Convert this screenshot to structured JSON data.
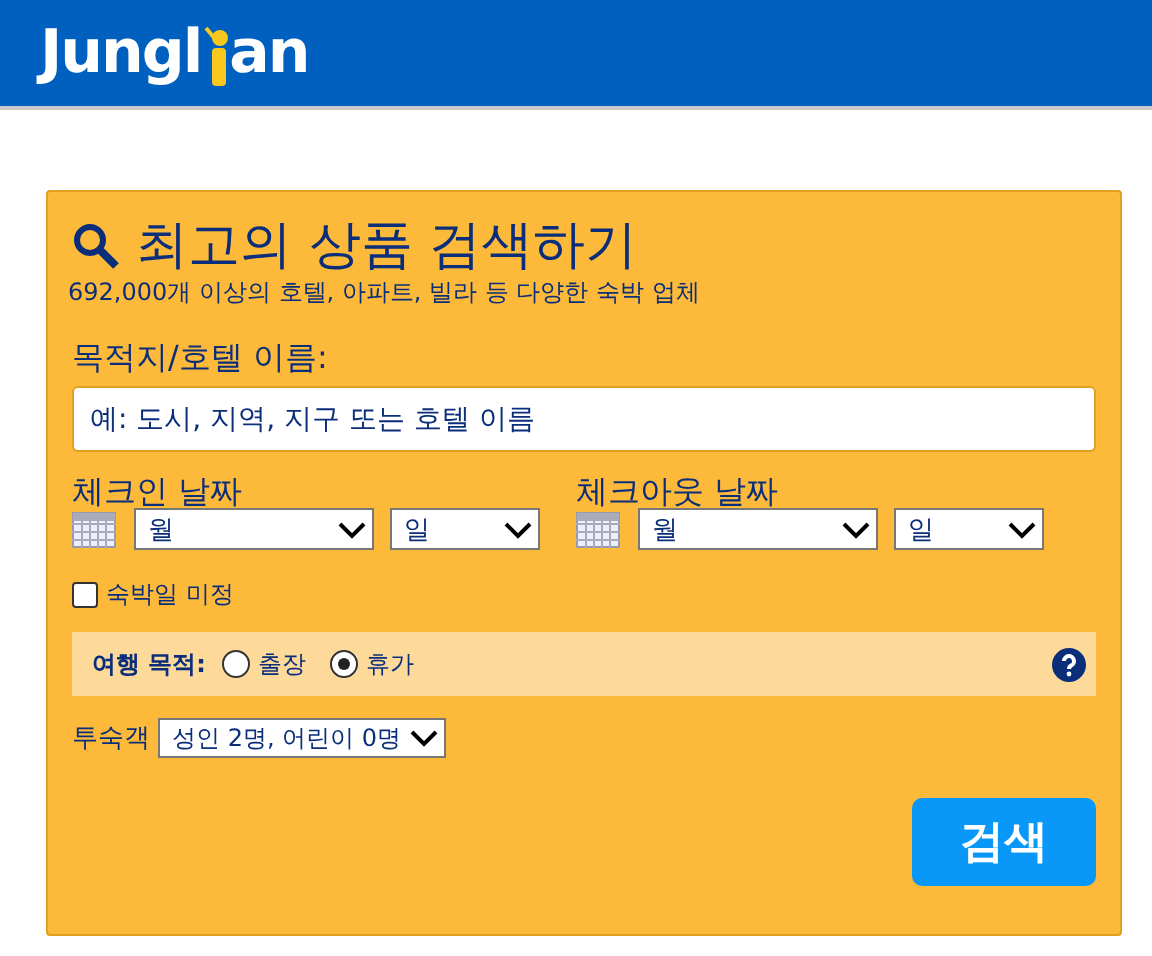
{
  "logo": {
    "before": "Jungl",
    "after": "an"
  },
  "search": {
    "title": "최고의 상품 검색하기",
    "subtitle": "692,000개 이상의 호텔, 아파트, 빌라 등 다양한 숙박 업체",
    "destination": {
      "label": "목적지/호텔 이름:",
      "placeholder": "예: 도시, 지역, 지구 또는 호텔 이름"
    },
    "dates": [
      {
        "label": "체크인 날짜",
        "month": "월",
        "day": "일"
      },
      {
        "label": "체크아웃 날짜",
        "month": "월",
        "day": "일"
      }
    ],
    "undecided": {
      "label": "숙박일 미정",
      "checked": false
    },
    "purpose": {
      "label": "여행 목적:",
      "options": [
        {
          "label": "출장",
          "selected": false
        },
        {
          "label": "휴가",
          "selected": true
        }
      ]
    },
    "guests": {
      "label": "투숙객",
      "value": "성인 2명, 어린이 0명"
    },
    "button": "검색"
  }
}
